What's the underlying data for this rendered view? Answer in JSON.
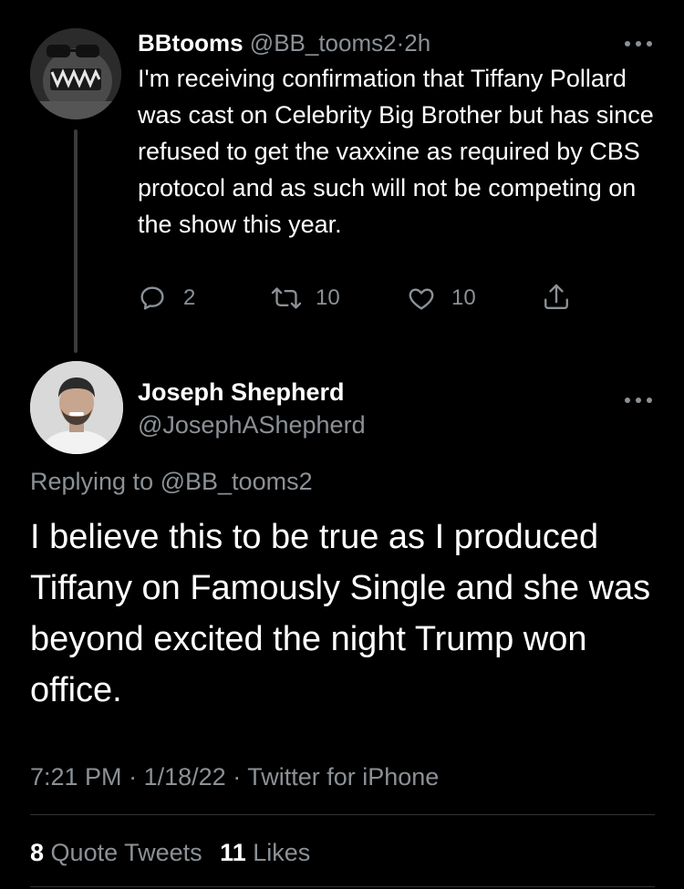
{
  "parent_tweet": {
    "display_name": "BBtooms",
    "handle": "@BB_tooms2",
    "separator": "·",
    "time": "2h",
    "more_icon": "more-horizontal-icon",
    "text": "I'm receiving confirmation that Tiffany Pollard was cast on Celebrity Big Brother but has since refused to get the vaxxine as required by CBS protocol and as such will not be competing on the show this year.",
    "actions": {
      "replies": "2",
      "retweets": "10",
      "likes": "10",
      "share_icon": "share-icon"
    }
  },
  "reply_tweet": {
    "display_name": "Joseph Shepherd",
    "handle": "@JosephAShepherd",
    "replying_prefix": "Replying to",
    "replying_to": "@BB_tooms2",
    "text": "I believe this to be true as I produced Tiffany on Famously Single and she was beyond excited the night Trump won office.",
    "meta": {
      "time": "7:21 PM",
      "date": "1/18/22",
      "source": "Twitter for iPhone",
      "separator": "·"
    },
    "stats": {
      "quote_count": "8",
      "quote_label": "Quote Tweets",
      "like_count": "11",
      "like_label": "Likes"
    }
  },
  "colors": {
    "background": "#000000",
    "primary_text": "#ffffff",
    "secondary_text": "#8b9196",
    "divider": "#2f3336"
  }
}
